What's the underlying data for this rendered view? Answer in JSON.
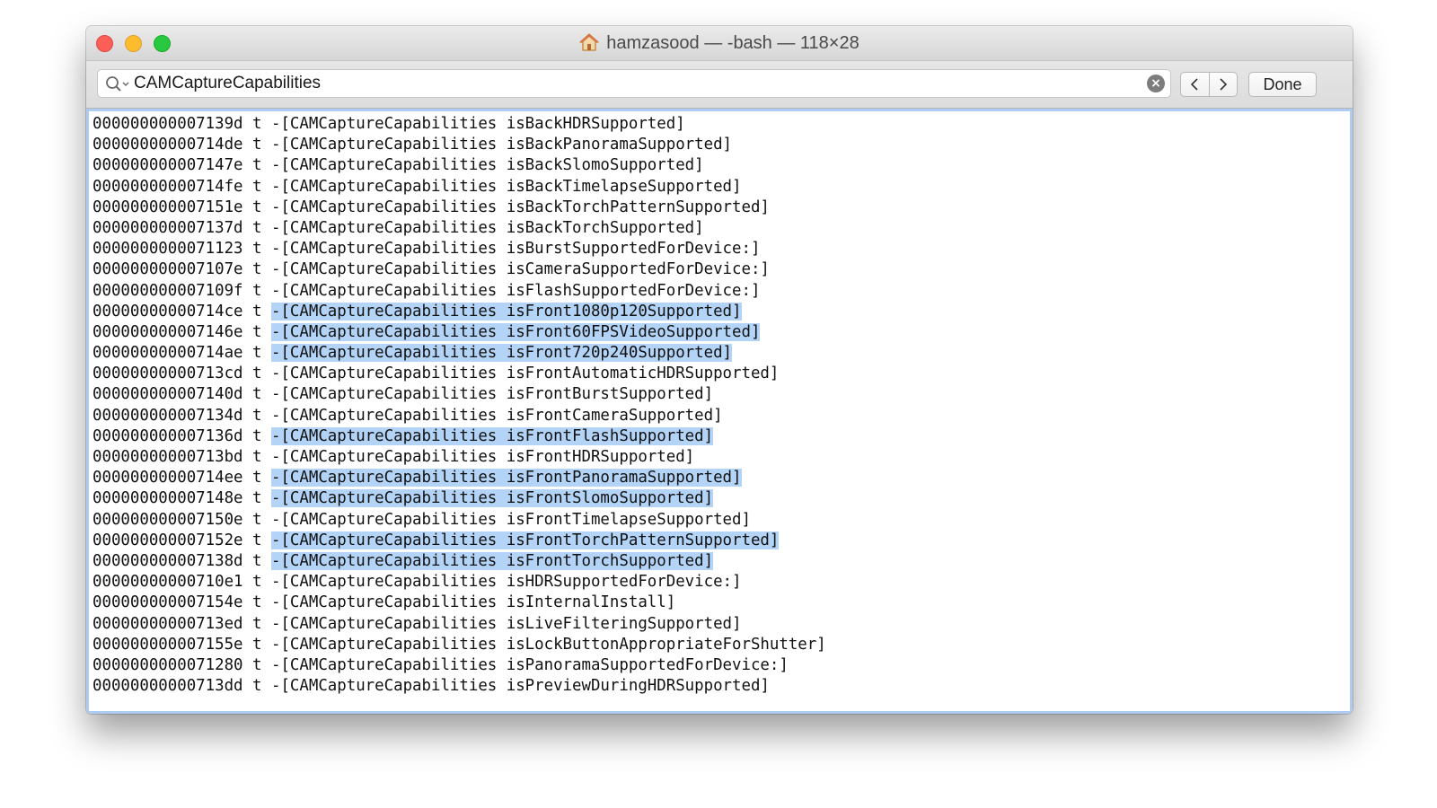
{
  "window": {
    "title": "hamzasood — -bash — 118×28"
  },
  "find_bar": {
    "query": "CAMCaptureCapabilities",
    "done_label": "Done"
  },
  "icons": {
    "title": "home-icon",
    "search": "search-icon",
    "clear": "clear-icon",
    "prev": "chevron-left-icon",
    "next": "chevron-right-icon"
  },
  "colors": {
    "highlight": "#b3d4f7",
    "focus_ring": "#aecbf2",
    "close": "#fc5f57",
    "minimize": "#fdbc2e",
    "zoom": "#28c840"
  },
  "terminal": {
    "lines": [
      {
        "addr": "000000000007139d",
        "type": "t",
        "sym": "-[CAMCaptureCapabilities isBackHDRSupported]",
        "highlighted": false
      },
      {
        "addr": "00000000000714de",
        "type": "t",
        "sym": "-[CAMCaptureCapabilities isBackPanoramaSupported]",
        "highlighted": false
      },
      {
        "addr": "000000000007147e",
        "type": "t",
        "sym": "-[CAMCaptureCapabilities isBackSlomoSupported]",
        "highlighted": false
      },
      {
        "addr": "00000000000714fe",
        "type": "t",
        "sym": "-[CAMCaptureCapabilities isBackTimelapseSupported]",
        "highlighted": false
      },
      {
        "addr": "000000000007151e",
        "type": "t",
        "sym": "-[CAMCaptureCapabilities isBackTorchPatternSupported]",
        "highlighted": false
      },
      {
        "addr": "000000000007137d",
        "type": "t",
        "sym": "-[CAMCaptureCapabilities isBackTorchSupported]",
        "highlighted": false
      },
      {
        "addr": "0000000000071123",
        "type": "t",
        "sym": "-[CAMCaptureCapabilities isBurstSupportedForDevice:]",
        "highlighted": false
      },
      {
        "addr": "000000000007107e",
        "type": "t",
        "sym": "-[CAMCaptureCapabilities isCameraSupportedForDevice:]",
        "highlighted": false
      },
      {
        "addr": "000000000007109f",
        "type": "t",
        "sym": "-[CAMCaptureCapabilities isFlashSupportedForDevice:]",
        "highlighted": false
      },
      {
        "addr": "00000000000714ce",
        "type": "t",
        "sym": "-[CAMCaptureCapabilities isFront1080p120Supported]",
        "highlighted": true
      },
      {
        "addr": "000000000007146e",
        "type": "t",
        "sym": "-[CAMCaptureCapabilities isFront60FPSVideoSupported]",
        "highlighted": true
      },
      {
        "addr": "00000000000714ae",
        "type": "t",
        "sym": "-[CAMCaptureCapabilities isFront720p240Supported]",
        "highlighted": true
      },
      {
        "addr": "00000000000713cd",
        "type": "t",
        "sym": "-[CAMCaptureCapabilities isFrontAutomaticHDRSupported]",
        "highlighted": false
      },
      {
        "addr": "000000000007140d",
        "type": "t",
        "sym": "-[CAMCaptureCapabilities isFrontBurstSupported]",
        "highlighted": false
      },
      {
        "addr": "000000000007134d",
        "type": "t",
        "sym": "-[CAMCaptureCapabilities isFrontCameraSupported]",
        "highlighted": false
      },
      {
        "addr": "000000000007136d",
        "type": "t",
        "sym": "-[CAMCaptureCapabilities isFrontFlashSupported]",
        "highlighted": true
      },
      {
        "addr": "00000000000713bd",
        "type": "t",
        "sym": "-[CAMCaptureCapabilities isFrontHDRSupported]",
        "highlighted": false
      },
      {
        "addr": "00000000000714ee",
        "type": "t",
        "sym": "-[CAMCaptureCapabilities isFrontPanoramaSupported]",
        "highlighted": true
      },
      {
        "addr": "000000000007148e",
        "type": "t",
        "sym": "-[CAMCaptureCapabilities isFrontSlomoSupported]",
        "highlighted": true
      },
      {
        "addr": "000000000007150e",
        "type": "t",
        "sym": "-[CAMCaptureCapabilities isFrontTimelapseSupported]",
        "highlighted": false
      },
      {
        "addr": "000000000007152e",
        "type": "t",
        "sym": "-[CAMCaptureCapabilities isFrontTorchPatternSupported]",
        "highlighted": true
      },
      {
        "addr": "000000000007138d",
        "type": "t",
        "sym": "-[CAMCaptureCapabilities isFrontTorchSupported]",
        "highlighted": true
      },
      {
        "addr": "00000000000710e1",
        "type": "t",
        "sym": "-[CAMCaptureCapabilities isHDRSupportedForDevice:]",
        "highlighted": false
      },
      {
        "addr": "000000000007154e",
        "type": "t",
        "sym": "-[CAMCaptureCapabilities isInternalInstall]",
        "highlighted": false
      },
      {
        "addr": "00000000000713ed",
        "type": "t",
        "sym": "-[CAMCaptureCapabilities isLiveFilteringSupported]",
        "highlighted": false
      },
      {
        "addr": "000000000007155e",
        "type": "t",
        "sym": "-[CAMCaptureCapabilities isLockButtonAppropriateForShutter]",
        "highlighted": false
      },
      {
        "addr": "0000000000071280",
        "type": "t",
        "sym": "-[CAMCaptureCapabilities isPanoramaSupportedForDevice:]",
        "highlighted": false
      },
      {
        "addr": "00000000000713dd",
        "type": "t",
        "sym": "-[CAMCaptureCapabilities isPreviewDuringHDRSupported]",
        "highlighted": false
      }
    ]
  }
}
